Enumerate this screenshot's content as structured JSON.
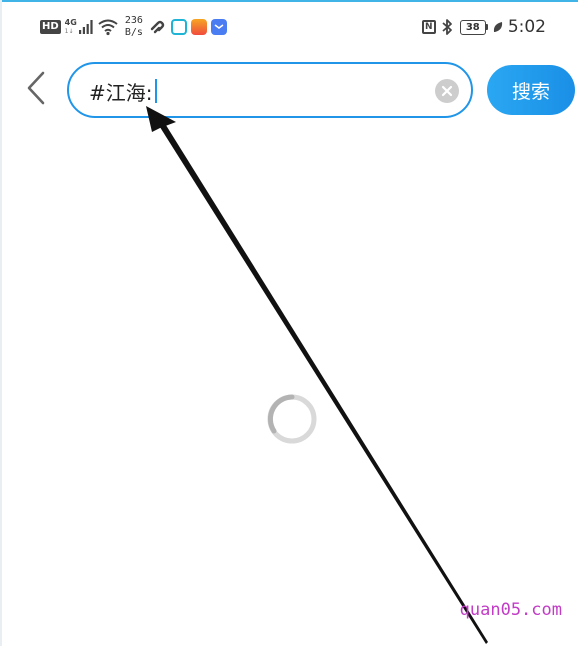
{
  "status_bar": {
    "hd_label": "HD",
    "network_type": "4G",
    "network_sub": "1↓",
    "speed_value": "236",
    "speed_unit": "B/s",
    "app_icons": [
      "link-app",
      "message-app",
      "video-app",
      "mail-app"
    ],
    "nfc_label": "N",
    "battery_level": "38",
    "time": "5:02",
    "colors": {
      "icon_dark": "#444444",
      "app_teal": "#1fb3d6",
      "app_red": "#f04b3c",
      "app_blue": "#4a7df2"
    }
  },
  "header": {
    "back_icon": "chevron-left-icon",
    "search": {
      "value": "#江海:",
      "clear_icon": "clear-circle-icon"
    },
    "search_button_label": "搜索",
    "accent_color": "#2196e8"
  },
  "main": {
    "loading_icon": "spinner-icon"
  },
  "annotation": {
    "arrow_icon": "pointer-arrow-icon"
  },
  "watermark": "quan05.com"
}
